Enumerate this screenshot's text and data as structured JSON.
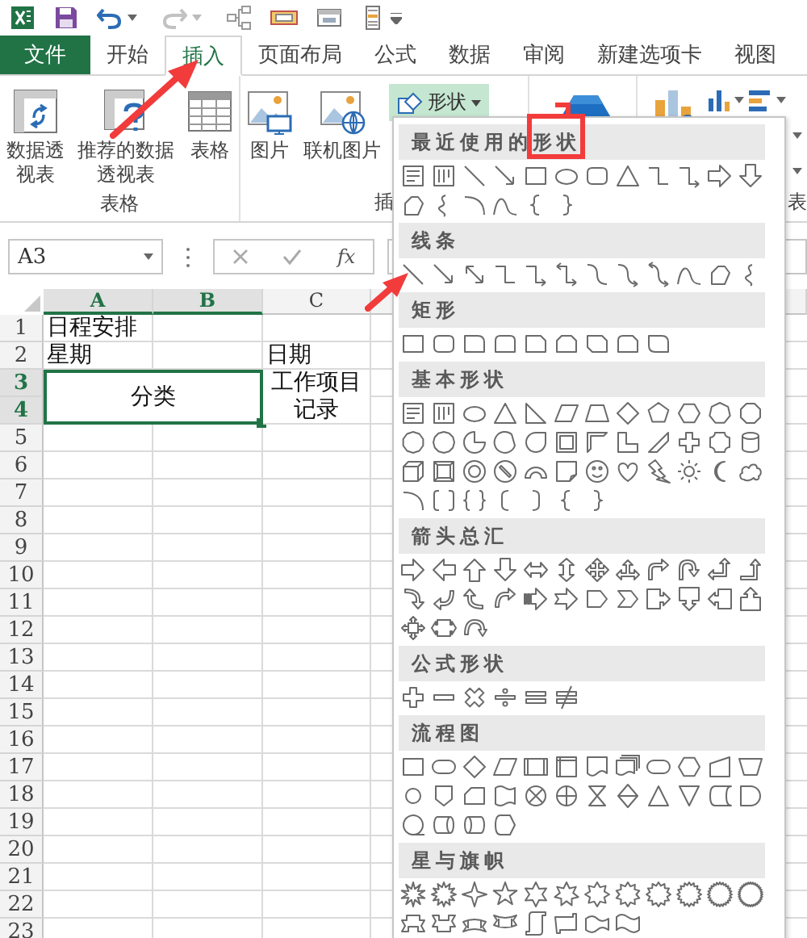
{
  "tabs": [
    {
      "label": "文件",
      "kind": "file",
      "selected": false
    },
    {
      "label": "开始",
      "kind": "tab",
      "selected": false
    },
    {
      "label": "插入",
      "kind": "tab",
      "selected": true
    },
    {
      "label": "页面布局",
      "kind": "tab",
      "selected": false
    },
    {
      "label": "公式",
      "kind": "tab",
      "selected": false
    },
    {
      "label": "数据",
      "kind": "tab",
      "selected": false
    },
    {
      "label": "审阅",
      "kind": "tab",
      "selected": false
    },
    {
      "label": "新建选项卡",
      "kind": "tab",
      "selected": false
    },
    {
      "label": "视图",
      "kind": "tab",
      "selected": false
    }
  ],
  "ribbon": {
    "groups": [
      {
        "label": "表格",
        "buttons": [
          {
            "label": "数据透视表",
            "kind": "pivot"
          },
          {
            "label": "推荐的数据透视表",
            "kind": "recommended"
          },
          {
            "label": "表格",
            "kind": "table"
          }
        ]
      },
      {
        "label": "插",
        "buttons": [
          {
            "label": "图片",
            "kind": "picture"
          },
          {
            "label": "联机图片",
            "kind": "online"
          }
        ],
        "dropdown": {
          "label": "形状",
          "expanded": true
        }
      },
      {
        "kind": "store"
      },
      {
        "label": "表",
        "kind": "charts"
      }
    ]
  },
  "formula_bar": {
    "name_box": "A3",
    "function_label": "fx"
  },
  "sheet": {
    "columns": [
      {
        "label": "A",
        "selected": true
      },
      {
        "label": "B",
        "selected": true
      },
      {
        "label": "C",
        "selected": false
      }
    ],
    "rows": [
      {
        "number": "1",
        "selected": false,
        "cells": [
          {
            "text": "日程安排"
          }
        ]
      },
      {
        "number": "2",
        "selected": false,
        "cells": [
          {
            "text": "星期"
          },
          {
            "text": ""
          },
          {
            "text": "日期"
          }
        ]
      },
      {
        "number": "3",
        "selected": true,
        "cells": [
          {
            "text": "分类",
            "merge_right": true,
            "merge_down": true,
            "selected": true
          },
          {
            "text": ""
          },
          {
            "text": "工作项目记录",
            "merge_down": true
          }
        ]
      },
      {
        "number": "4",
        "selected": true,
        "cells": []
      },
      {
        "number": "5",
        "selected": false,
        "cells": []
      },
      {
        "number": "6",
        "selected": false,
        "cells": []
      },
      {
        "number": "7",
        "selected": false,
        "cells": []
      },
      {
        "number": "8",
        "selected": false,
        "cells": []
      },
      {
        "number": "9",
        "selected": false,
        "cells": []
      },
      {
        "number": "10",
        "selected": false,
        "cells": []
      },
      {
        "number": "11",
        "selected": false,
        "cells": []
      },
      {
        "number": "12",
        "selected": false,
        "cells": []
      },
      {
        "number": "13",
        "selected": false,
        "cells": []
      },
      {
        "number": "14",
        "selected": false,
        "cells": []
      },
      {
        "number": "15",
        "selected": false,
        "cells": []
      },
      {
        "number": "16",
        "selected": false,
        "cells": []
      },
      {
        "number": "17",
        "selected": false,
        "cells": []
      },
      {
        "number": "18",
        "selected": false,
        "cells": []
      },
      {
        "number": "19",
        "selected": false,
        "cells": []
      },
      {
        "number": "20",
        "selected": false,
        "cells": []
      },
      {
        "number": "21",
        "selected": false,
        "cells": []
      },
      {
        "number": "22",
        "selected": false,
        "cells": []
      },
      {
        "number": "23",
        "selected": false,
        "cells": []
      }
    ]
  },
  "shapes_menu": {
    "sections": [
      {
        "title": "最近使用的形状",
        "rows": [
          [
            {
              "kind": "textbox"
            },
            {
              "kind": "vtextbox"
            },
            {
              "kind": "line"
            },
            {
              "kind": "arrowline"
            },
            {
              "kind": "rectangle"
            },
            {
              "kind": "oval"
            },
            {
              "kind": "roundrect"
            },
            {
              "kind": "triangle"
            },
            {
              "kind": "elbow"
            },
            {
              "kind": "elbowarrow"
            },
            {
              "kind": "rightarrow"
            },
            {
              "kind": "downarrow"
            }
          ],
          [
            {
              "kind": "freeform"
            },
            {
              "kind": "scribble"
            },
            {
              "kind": "arc"
            },
            {
              "kind": "curve"
            },
            {
              "kind": "leftbrace"
            },
            {
              "kind": "rightbrace"
            }
          ]
        ]
      },
      {
        "title": "线条",
        "rows": [
          [
            {
              "kind": "line"
            },
            {
              "kind": "arrowline"
            },
            {
              "kind": "doublearrow"
            },
            {
              "kind": "elbow"
            },
            {
              "kind": "elbowarrow"
            },
            {
              "kind": "elbowdouble"
            },
            {
              "kind": "curved"
            },
            {
              "kind": "curvedarrow"
            },
            {
              "kind": "curveddouble"
            },
            {
              "kind": "curve"
            },
            {
              "kind": "freeform"
            },
            {
              "kind": "scribble"
            }
          ]
        ]
      },
      {
        "title": "矩形",
        "rows": [
          [
            {
              "kind": "rectangle"
            },
            {
              "kind": "roundrect"
            },
            {
              "kind": "roundcorner"
            },
            {
              "kind": "roundsame"
            },
            {
              "kind": "snipcorner"
            },
            {
              "kind": "snipsame"
            },
            {
              "kind": "snipdiagonal"
            },
            {
              "kind": "roundsnip"
            },
            {
              "kind": "rounddiagonal"
            }
          ]
        ]
      },
      {
        "title": "基本形状",
        "rows": [
          [
            {
              "kind": "textbox"
            },
            {
              "kind": "vtextbox"
            },
            {
              "kind": "oval"
            },
            {
              "kind": "triangle"
            },
            {
              "kind": "righttriangle"
            },
            {
              "kind": "parallelogram"
            },
            {
              "kind": "trapezoid"
            },
            {
              "kind": "diamond"
            },
            {
              "kind": "pentagon"
            },
            {
              "kind": "hexagon"
            },
            {
              "kind": "heptagon"
            },
            {
              "kind": "octagon"
            }
          ],
          [
            {
              "kind": "decagon"
            },
            {
              "kind": "dodecagon"
            },
            {
              "kind": "pie"
            },
            {
              "kind": "chord"
            },
            {
              "kind": "teardrop"
            },
            {
              "kind": "frame"
            },
            {
              "kind": "halfframe"
            },
            {
              "kind": "lshape"
            },
            {
              "kind": "diagonalstripe"
            },
            {
              "kind": "cross"
            },
            {
              "kind": "plaque"
            },
            {
              "kind": "can"
            }
          ],
          [
            {
              "kind": "cube"
            },
            {
              "kind": "bevel"
            },
            {
              "kind": "donut"
            },
            {
              "kind": "nosymbol"
            },
            {
              "kind": "blockarc"
            },
            {
              "kind": "foldedcorner"
            },
            {
              "kind": "smiley"
            },
            {
              "kind": "heart"
            },
            {
              "kind": "lightning"
            },
            {
              "kind": "sun"
            },
            {
              "kind": "moon"
            },
            {
              "kind": "cloud"
            }
          ],
          [
            {
              "kind": "arc"
            },
            {
              "kind": "bracketpair"
            },
            {
              "kind": "bracepair"
            },
            {
              "kind": "leftbracket"
            },
            {
              "kind": "rightbracket"
            },
            {
              "kind": "leftbrace"
            },
            {
              "kind": "rightbrace"
            }
          ]
        ]
      },
      {
        "title": "箭头总汇",
        "rows": [
          [
            {
              "kind": "rightarrow"
            },
            {
              "kind": "leftarrow"
            },
            {
              "kind": "uparrow"
            },
            {
              "kind": "downarrow"
            },
            {
              "kind": "leftrightarrow"
            },
            {
              "kind": "updownarrow"
            },
            {
              "kind": "quadarrow"
            },
            {
              "kind": "leftrightup"
            },
            {
              "kind": "bentarrow"
            },
            {
              "kind": "uturn"
            },
            {
              "kind": "leftup"
            },
            {
              "kind": "bentup"
            }
          ],
          [
            {
              "kind": "curvedright"
            },
            {
              "kind": "curvedleft"
            },
            {
              "kind": "curvedup"
            },
            {
              "kind": "curveddown"
            },
            {
              "kind": "stripedarrow"
            },
            {
              "kind": "notchedarrow"
            },
            {
              "kind": "pentarrow"
            },
            {
              "kind": "chevron"
            },
            {
              "kind": "rightcallout"
            },
            {
              "kind": "downcallout"
            },
            {
              "kind": "leftcallout"
            },
            {
              "kind": "upcallout"
            }
          ],
          [
            {
              "kind": "quadcallout"
            },
            {
              "kind": "leftrightcallout"
            },
            {
              "kind": "circulararrow"
            }
          ]
        ]
      },
      {
        "title": "公式形状",
        "rows": [
          [
            {
              "kind": "cross"
            },
            {
              "kind": "minus"
            },
            {
              "kind": "multiply"
            },
            {
              "kind": "divide"
            },
            {
              "kind": "equal"
            },
            {
              "kind": "notequal"
            }
          ]
        ]
      },
      {
        "title": "流程图",
        "rows": [
          [
            {
              "kind": "rectangle"
            },
            {
              "kind": "terminator"
            },
            {
              "kind": "diamond"
            },
            {
              "kind": "parallelogram"
            },
            {
              "kind": "predefined"
            },
            {
              "kind": "internal"
            },
            {
              "kind": "document"
            },
            {
              "kind": "multidocument"
            },
            {
              "kind": "terminator"
            },
            {
              "kind": "hexagon"
            },
            {
              "kind": "manualinput"
            },
            {
              "kind": "manualop"
            }
          ],
          [
            {
              "kind": "connector"
            },
            {
              "kind": "offpage"
            },
            {
              "kind": "card"
            },
            {
              "kind": "punchedtape"
            },
            {
              "kind": "sumjunction"
            },
            {
              "kind": "orjunction"
            },
            {
              "kind": "collate"
            },
            {
              "kind": "sort"
            },
            {
              "kind": "extract"
            },
            {
              "kind": "merge"
            },
            {
              "kind": "storeddata"
            },
            {
              "kind": "delay"
            }
          ],
          [
            {
              "kind": "seqaccess"
            },
            {
              "kind": "disk"
            },
            {
              "kind": "directaccess"
            },
            {
              "kind": "display"
            }
          ]
        ]
      },
      {
        "title": "星与旗帜",
        "rows": [
          [
            {
              "kind": "explosion"
            },
            {
              "kind": "burst"
            },
            {
              "kind": "star4"
            },
            {
              "kind": "star5"
            },
            {
              "kind": "star6"
            },
            {
              "kind": "star7"
            },
            {
              "kind": "star8"
            },
            {
              "kind": "star10"
            },
            {
              "kind": "star12"
            },
            {
              "kind": "star16"
            },
            {
              "kind": "star24"
            },
            {
              "kind": "star32"
            }
          ],
          [
            {
              "kind": "ribbonup"
            },
            {
              "kind": "ribbondown"
            },
            {
              "kind": "curvedribbonup"
            },
            {
              "kind": "curvedribbondown"
            },
            {
              "kind": "verticalscroll"
            },
            {
              "kind": "horizontalscroll"
            },
            {
              "kind": "wave"
            },
            {
              "kind": "doublewave"
            }
          ]
        ]
      }
    ]
  }
}
